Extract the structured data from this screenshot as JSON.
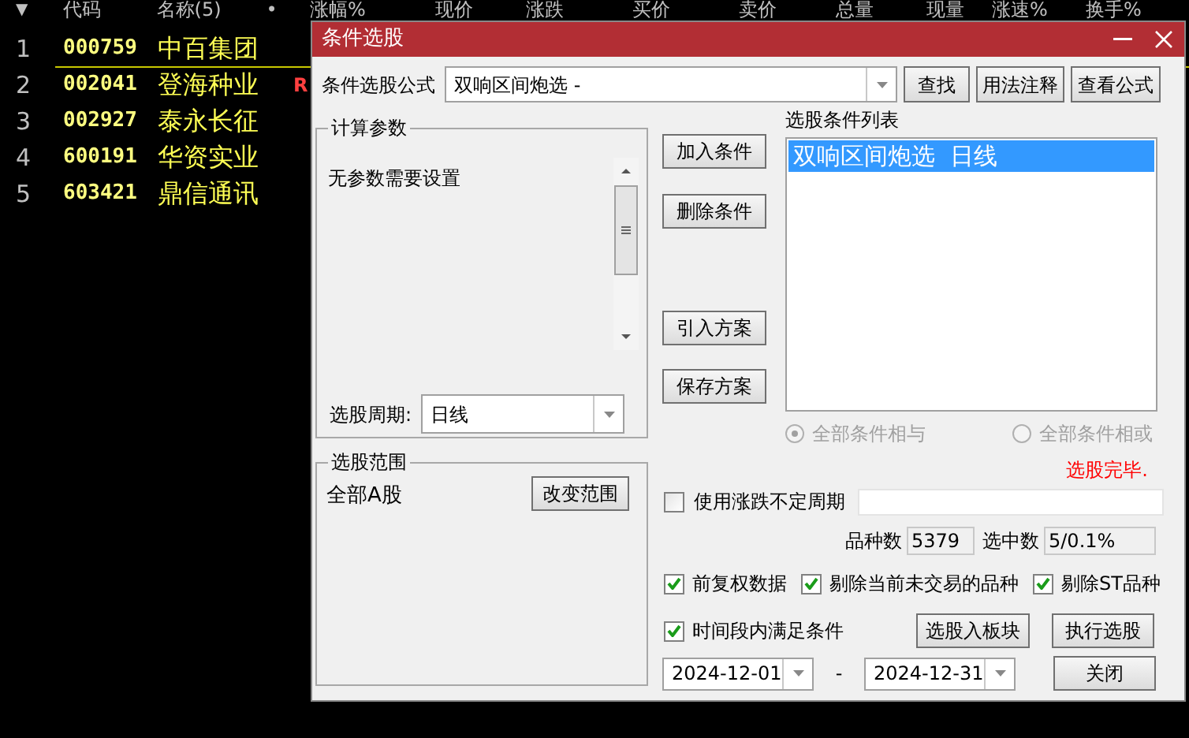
{
  "stock_list": {
    "columns": [
      "▼",
      "代码",
      "名称(5)",
      "•",
      "涨幅%",
      "现价",
      "涨跌",
      "买价",
      "卖价",
      "总量",
      "现量",
      "涨速%",
      "换手%"
    ],
    "rows": [
      {
        "index": "1",
        "code": "000759",
        "name": "中百集团",
        "selected": true
      },
      {
        "index": "2",
        "code": "002041",
        "name": "登海种业",
        "flag": "R",
        "selected": false
      },
      {
        "index": "3",
        "code": "002927",
        "name": "泰永长征",
        "selected": false
      },
      {
        "index": "4",
        "code": "600191",
        "name": "华资实业",
        "selected": false
      },
      {
        "index": "5",
        "code": "603421",
        "name": "鼎信通讯",
        "selected": false
      }
    ]
  },
  "dialog": {
    "title": "条件选股",
    "formula_label": "条件选股公式",
    "formula_value": "双响区间炮选 -",
    "top_buttons": [
      "查找",
      "用法注释",
      "查看公式"
    ],
    "params_group": {
      "title": "计算参数",
      "message": "无参数需要设置",
      "period_label": "选股周期:",
      "period_value": "日线"
    },
    "range_group": {
      "title": "选股范围",
      "value": "全部A股",
      "button": "改变范围"
    },
    "action_buttons": [
      "加入条件",
      "删除条件",
      "引入方案",
      "保存方案"
    ],
    "condition_list": {
      "title": "选股条件列表",
      "items": [
        {
          "text": "双响区间炮选  日线",
          "selected": true
        }
      ]
    },
    "logic_options": [
      {
        "label": "全部条件相与",
        "selected": true,
        "disabled": true
      },
      {
        "label": "全部条件相或",
        "selected": false,
        "disabled": true
      }
    ],
    "status": "选股完毕.",
    "variable_period": {
      "label": "使用涨跌不定周期",
      "checked": false
    },
    "counts": [
      {
        "label": "品种数",
        "value": "5379"
      },
      {
        "label": "选中数",
        "value": "5/0.1%"
      }
    ],
    "options": [
      {
        "label": "前复权数据",
        "checked": true
      },
      {
        "label": "剔除当前未交易的品种",
        "checked": true
      },
      {
        "label": "剔除ST品种",
        "checked": true
      }
    ],
    "time_condition": {
      "label": "时间段内满足条件",
      "checked": true
    },
    "bottom_buttons": [
      "选股入板块",
      "执行选股"
    ],
    "date_from": "2024-12-01",
    "date_separator": "-",
    "date_to": "2024-12-31",
    "close_button": "关闭"
  }
}
